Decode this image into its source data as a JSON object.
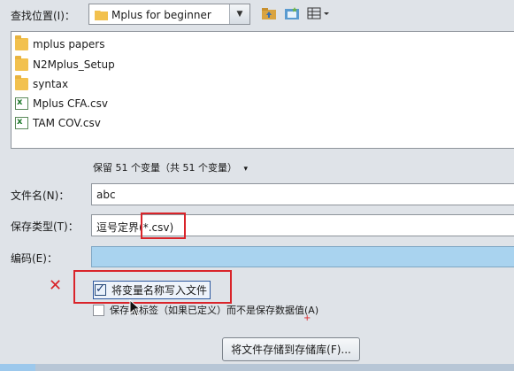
{
  "look_in": {
    "label": "查找位置(I)：",
    "current_folder": "Mplus for beginner",
    "folder_icon": "folder-icon"
  },
  "toolbar": {
    "icons": [
      "up-folder-icon",
      "new-folder-icon",
      "view-menu-icon"
    ]
  },
  "file_list": {
    "items": [
      {
        "name": "mplus papers",
        "type": "folder"
      },
      {
        "name": "N2Mplus_Setup",
        "type": "folder"
      },
      {
        "name": "syntax",
        "type": "folder"
      },
      {
        "name": "Mplus CFA.csv",
        "type": "csv"
      },
      {
        "name": "TAM COV.csv",
        "type": "csv"
      }
    ]
  },
  "keep_variables": "保留 51 个变量（共 51 个变量）",
  "file_name": {
    "label": "文件名(N)：",
    "value": "abc"
  },
  "save_type": {
    "label": "保存类型(T)：",
    "value_prefix": "逗号定界",
    "value_ext": "(*.csv)"
  },
  "encoding": {
    "label": "编码(E)：",
    "value": ""
  },
  "write_varnames": {
    "label": "将变量名称写入文件",
    "checked": true
  },
  "save_labels": {
    "label": "保存值标签（如果已定义）而不是保存数据值(A)",
    "checked": false
  },
  "annotation": {
    "mark": "✕",
    "plus": "+"
  },
  "save_to_repo_button": "将文件存储到存储库(F)...",
  "colors": {
    "highlight_red": "#d9242a",
    "encoding_fill": "#a9d3ef"
  }
}
